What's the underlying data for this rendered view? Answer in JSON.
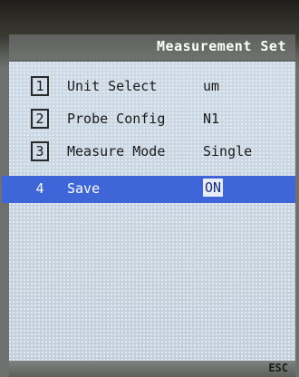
{
  "header": {
    "title": "Measurement Set"
  },
  "menu": {
    "items": [
      {
        "number": "1",
        "label": "Unit Select",
        "value": "um"
      },
      {
        "number": "2",
        "label": "Probe Config",
        "value": "N1"
      },
      {
        "number": "3",
        "label": "Measure Mode",
        "value": "Single"
      },
      {
        "number": "4",
        "label": "Save",
        "value": "ON",
        "selected": true
      }
    ]
  },
  "footer": {
    "esc_label": "ESC"
  },
  "colors": {
    "highlight": "#3e66d8",
    "screen_bg": "#c9d6e2",
    "header_bg": "#6a6d6a"
  }
}
